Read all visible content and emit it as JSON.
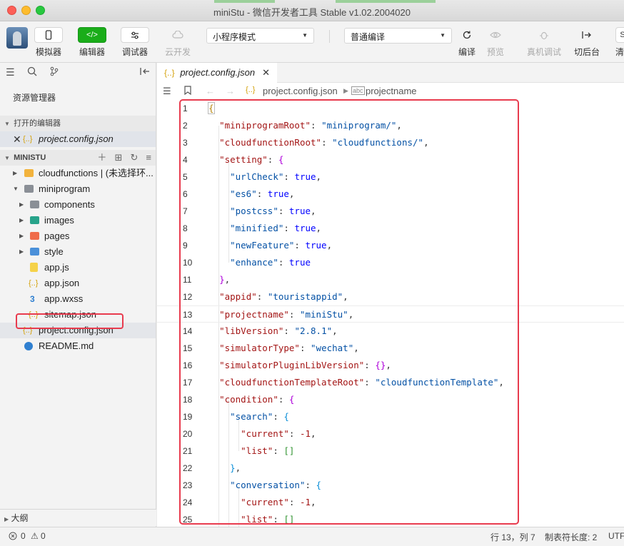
{
  "window": {
    "title": "miniStu - 微信开发者工具 Stable v1.02.2004020"
  },
  "toolbar": {
    "simulator": {
      "label": "模拟器",
      "icon": "phone-icon"
    },
    "editor": {
      "label": "编辑器",
      "icon": "code-icon"
    },
    "debugger": {
      "label": "调试器",
      "icon": "sliders-icon"
    },
    "cloud": {
      "label": "云开发",
      "icon": "cloud-icon"
    },
    "mode_select": "小程序模式",
    "compile_select": "普通编译",
    "compile": {
      "label": "编译",
      "icon": "refresh-icon"
    },
    "preview": {
      "label": "预览",
      "icon": "eye-icon"
    },
    "real_debug": {
      "label": "真机调试",
      "icon": "bug-icon"
    },
    "background": {
      "label": "切后台",
      "icon": "switch-icon"
    },
    "clear": {
      "label": "清"
    }
  },
  "sidebar": {
    "title": "资源管理器",
    "open_editors_header": "打开的编辑器",
    "open_editor_file": "project.config.json",
    "project_header": "MINISTU",
    "tree": [
      {
        "label": "cloudfunctions | (未选择环...",
        "icon": "folder-icon"
      },
      {
        "label": "miniprogram",
        "icon": "folder-icon"
      },
      {
        "label": "components",
        "icon": "folder-icon"
      },
      {
        "label": "images",
        "icon": "image-folder-icon"
      },
      {
        "label": "pages",
        "icon": "folder-icon"
      },
      {
        "label": "style",
        "icon": "folder-icon"
      },
      {
        "label": "app.js",
        "icon": "js-file-icon"
      },
      {
        "label": "app.json",
        "icon": "json-file-icon"
      },
      {
        "label": "app.wxss",
        "icon": "css-file-icon"
      },
      {
        "label": "sitemap.json",
        "icon": "json-file-icon"
      },
      {
        "label": "project.config.json",
        "icon": "json-file-icon"
      },
      {
        "label": "README.md",
        "icon": "info-icon"
      }
    ],
    "outline": "大纲"
  },
  "editor": {
    "tab_label": "project.config.json",
    "breadcrumb_file": "project.config.json",
    "breadcrumb_symbol": "projectname",
    "line_numbers": [
      "1",
      "2",
      "3",
      "4",
      "5",
      "6",
      "7",
      "8",
      "9",
      "10",
      "11",
      "12",
      "13",
      "14",
      "15",
      "16",
      "17",
      "18",
      "19",
      "20",
      "21",
      "22",
      "23",
      "24",
      "25"
    ]
  },
  "status": {
    "errors": "0",
    "warnings": "0",
    "position": "行 13，列 7",
    "tab_size": "制表符长度: 2",
    "encoding": "UTF"
  },
  "colors": {
    "accent": "#1aad19",
    "highlight_box": "#e83b4e"
  }
}
